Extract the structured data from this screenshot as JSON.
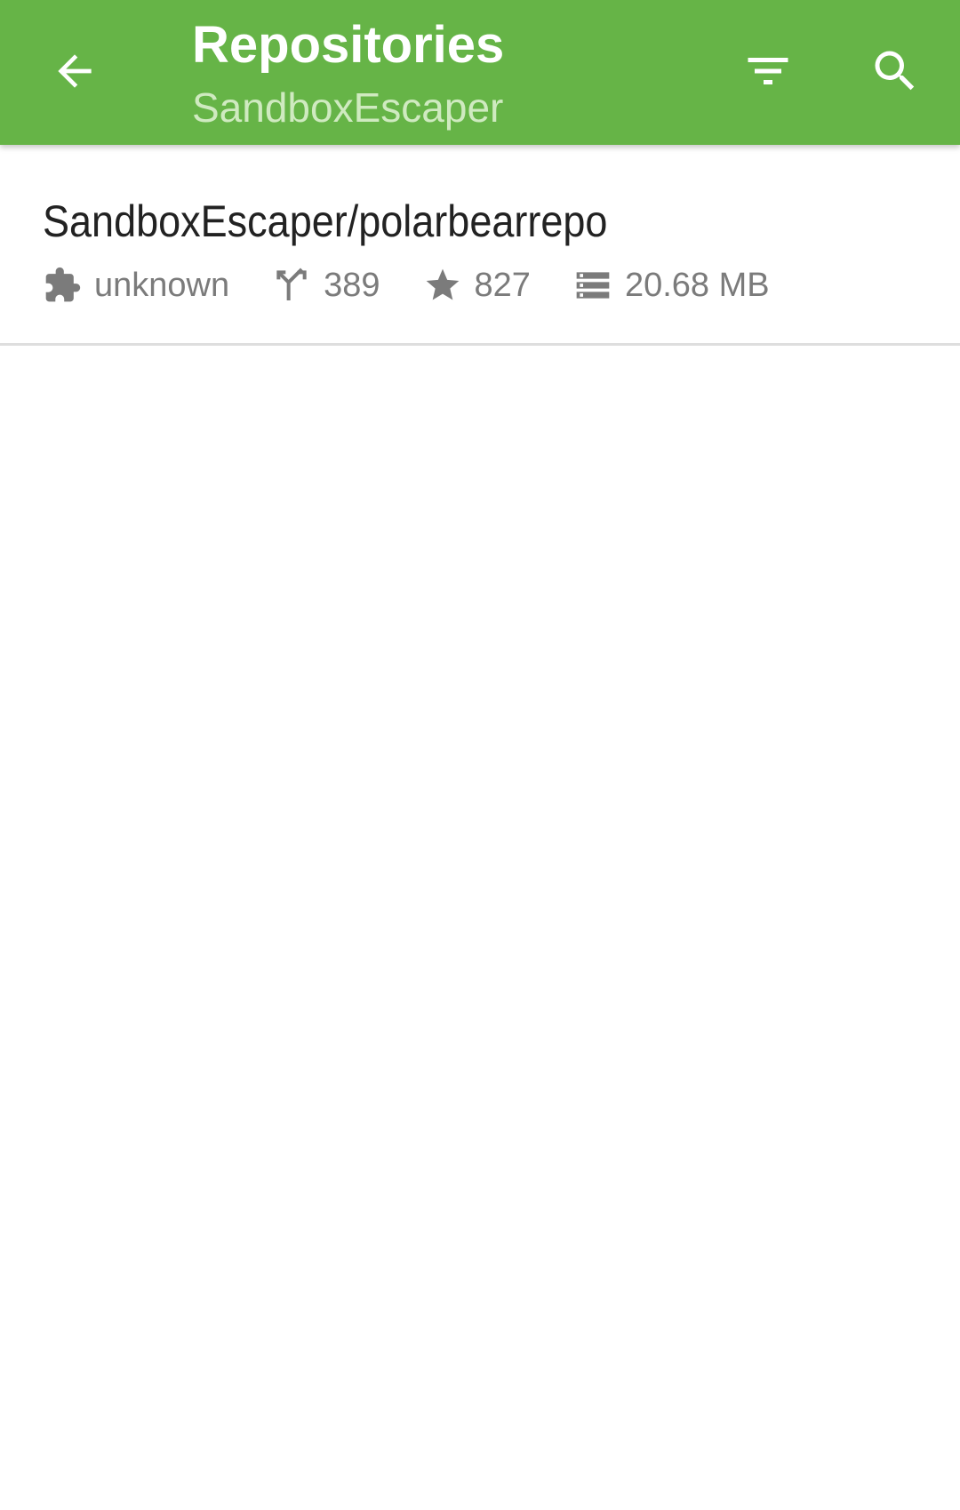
{
  "toolbar": {
    "title": "Repositories",
    "subtitle": "SandboxEscaper",
    "icons": {
      "back": "arrow-back-icon",
      "filter": "filter-icon",
      "search": "search-icon"
    },
    "colors": {
      "background": "#66b447",
      "title": "#ffffff",
      "subtitle": "#cfeac0"
    }
  },
  "repositories": [
    {
      "full_name": "SandboxEscaper/polarbearrepo",
      "language": "unknown",
      "forks": "389",
      "stars": "827",
      "size": "20.68 MB",
      "icons": {
        "language": "puzzle-piece-icon",
        "forks": "fork-icon",
        "stars": "star-icon",
        "size": "storage-icon"
      }
    }
  ]
}
